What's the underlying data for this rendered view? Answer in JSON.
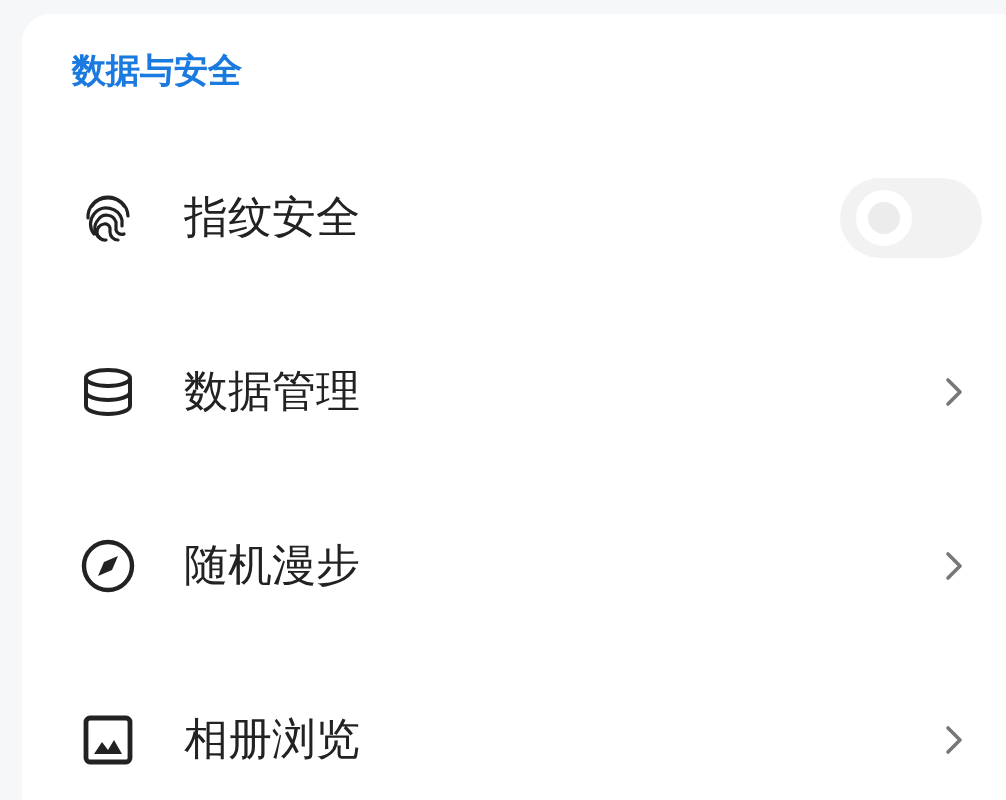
{
  "section": {
    "title": "数据与安全"
  },
  "items": [
    {
      "label": "指纹安全",
      "kind": "toggle",
      "on": false
    },
    {
      "label": "数据管理",
      "kind": "chevron"
    },
    {
      "label": "随机漫步",
      "kind": "chevron"
    },
    {
      "label": "相册浏览",
      "kind": "chevron"
    }
  ]
}
